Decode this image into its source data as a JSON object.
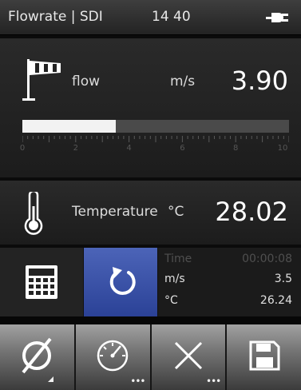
{
  "status_bar": {
    "title": "Flowrate | SDI",
    "time": "14 40",
    "icons": [
      "power-plug-icon"
    ]
  },
  "flow": {
    "icon": "windsock-icon",
    "label": "flow",
    "unit": "m/s",
    "value": "3.90",
    "bar_fraction": 0.35,
    "scale_labels": [
      "0",
      "2",
      "4",
      "6",
      "8",
      "10"
    ]
  },
  "temperature": {
    "icon": "thermometer-icon",
    "label": "Temperature",
    "unit": "°C",
    "value": "28.02"
  },
  "measurement": {
    "calculator_icon": "calculator-icon",
    "refresh_icon": "refresh-icon",
    "time_label": "Time",
    "time_value": "00:00:08",
    "speed_label": "m/s",
    "speed_value": "3.5",
    "temp_label": "°C",
    "temp_value": "26.24"
  },
  "toolbar": {
    "buttons": [
      "diameter-icon",
      "gauge-icon",
      "delete-icon",
      "save-icon"
    ]
  },
  "colors": {
    "accent_blue": "#3a52a8",
    "toolbar_gray": "#808080",
    "background": "#0b0b0b"
  }
}
